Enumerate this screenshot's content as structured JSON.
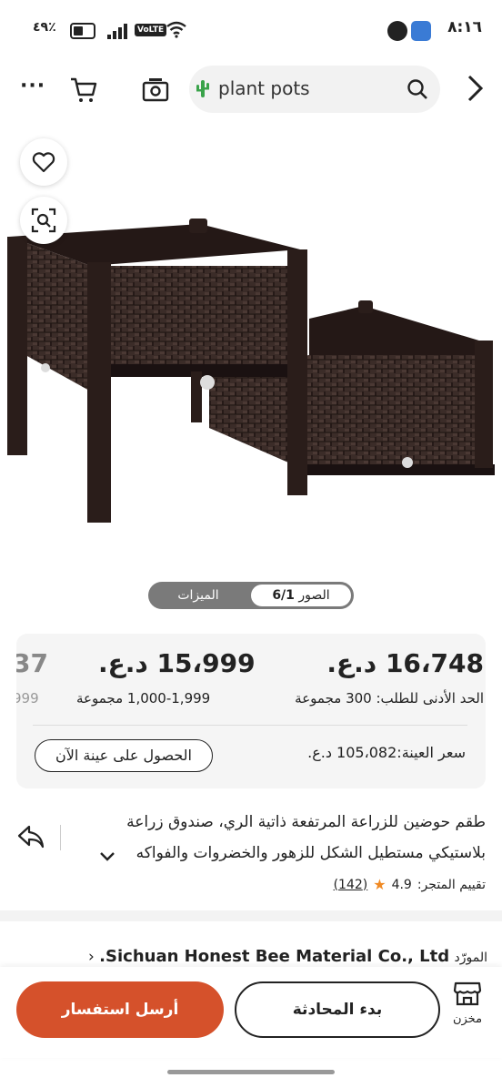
{
  "status_bar": {
    "time": "٨:١٦",
    "battery_text": "٤٩٪",
    "volte": "VoLTE",
    "icons": [
      "messenger-icon",
      "app-icon",
      "wifi-icon",
      "signal-icon",
      "battery-icon"
    ]
  },
  "search": {
    "query": "plant pots"
  },
  "gallery": {
    "tab_photos": "الصور",
    "photo_counter": "6/1",
    "tab_features": "الميزات"
  },
  "pricing": {
    "tier1_price": "16،748",
    "tier1_currency": "د.ع.",
    "tier1_moq": "الحد الأدنى للطلب: 300 مجموعة",
    "tier2_price": "15،999",
    "tier2_currency": "د.ع.",
    "tier2_moq": "1,000-1,999 مجموعة",
    "tier3_price": "37",
    "tier3_moq": "999",
    "sample_price": "سعر العينة:105،082 د.ع.",
    "sample_button": "الحصول على عينة الآن"
  },
  "product": {
    "title_line1": "طقم حوضين للزراعة المرتفعة ذاتية الري، صندوق زراعة",
    "title_line2": "بلاستيكي مستطيل الشكل للزهور والخضروات والفواكه",
    "rating_label": "تقييم المتجر:",
    "rating_value": "4.9",
    "rating_count": "(142)"
  },
  "supplier": {
    "label": "المورّد",
    "name": "Sichuan Honest Bee Material Co., Ltd."
  },
  "bottom_bar": {
    "store_label": "مخزن",
    "chat_button": "بدء المحادثة",
    "inquiry_button": "أرسل استفسار"
  },
  "colors": {
    "accent": "#d5512b",
    "star": "#f08a24",
    "card_bg": "#f5f5f5"
  }
}
